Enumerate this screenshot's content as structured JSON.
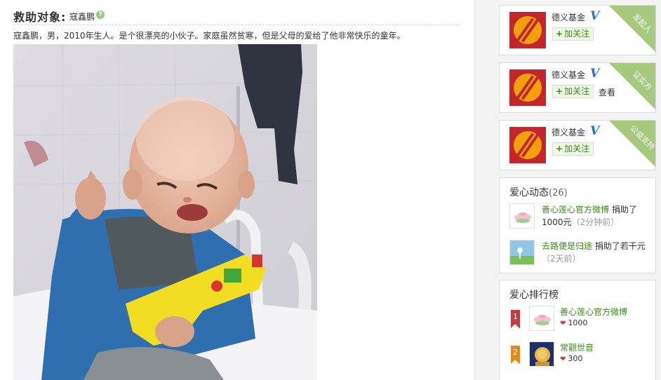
{
  "project": {
    "title": "救助对象",
    "colon": ":",
    "name": "寇鑫鹏",
    "help_icon": "?",
    "description": "寇鑫鹏，男，2010年生人。是个很漂亮的小伙子。家庭虽然贫寒，但是父母的爱给了他非常快乐的童年。"
  },
  "org_cards": [
    {
      "name": "德义基金",
      "verified_icon": "V",
      "follow_label": "加关注",
      "ribbon": "发起人",
      "view_label": ""
    },
    {
      "name": "德义基金",
      "verified_icon": "V",
      "follow_label": "加关注",
      "ribbon": "证实方",
      "view_label": "查看"
    },
    {
      "name": "德义基金",
      "verified_icon": "V",
      "follow_label": "加关注",
      "ribbon": "公益支持",
      "view_label": ""
    }
  ],
  "activity": {
    "title": "爱心动态",
    "count": "(26)",
    "items": [
      {
        "user": "善心莲心官方微博",
        "action": " 捐助了",
        "detail": "1000元",
        "time": "（2分钟前）",
        "avatar_icon": "lotus-icon"
      },
      {
        "user": "去路便是归途",
        "action": " 捐助了若干元",
        "detail": "",
        "time": "（2天前）",
        "avatar_icon": "landscape-icon"
      }
    ]
  },
  "ranking": {
    "title": "爱心排行榜",
    "items": [
      {
        "rank": "1",
        "user": "善心莲心官方微博",
        "amount": "1000",
        "color": "#c43b3b",
        "avatar_icon": "lotus-icon"
      },
      {
        "rank": "2",
        "user": "常觀世音",
        "amount": "300",
        "color": "#e38a1d",
        "avatar_icon": "buddha-icon"
      }
    ]
  },
  "colors": {
    "accent_green": "#3a8a1c",
    "ribbon_green": "#a5c97d",
    "verified_blue": "#2b6fcf",
    "logo_red": "#c1272d",
    "logo_orange": "#f2a10a"
  }
}
